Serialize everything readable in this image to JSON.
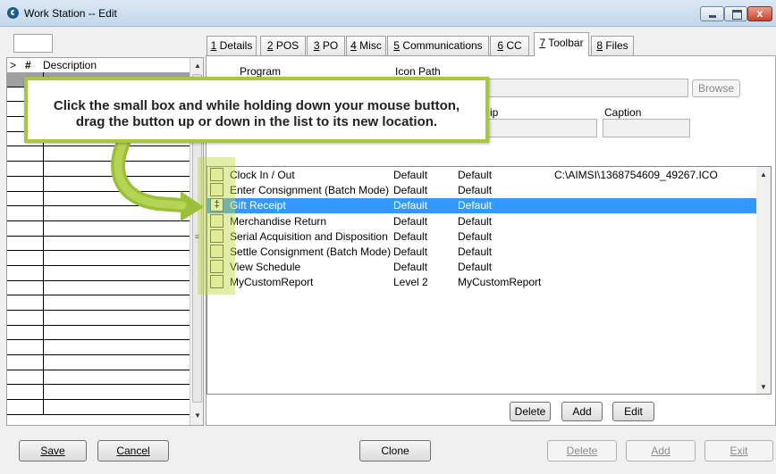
{
  "window": {
    "title": "Work Station -- Edit",
    "close_glyph": "x"
  },
  "left_list": {
    "headers": {
      "arrow": ">",
      "num": "#",
      "desc": "Description"
    },
    "row_count": 23,
    "selected_row": 0
  },
  "tabs": [
    {
      "key": "1",
      "label": " Details"
    },
    {
      "key": "2",
      "label": " POS"
    },
    {
      "key": "3",
      "label": " PO"
    },
    {
      "key": "4",
      "label": " Misc"
    },
    {
      "key": "5",
      "label": " Communications"
    },
    {
      "key": "6",
      "label": " CC"
    },
    {
      "key": "7",
      "label": " Toolbar"
    },
    {
      "key": "8",
      "label": " Files"
    }
  ],
  "active_tab": "7",
  "form": {
    "program_label": "Program",
    "icon_path_label": "Icon Path",
    "browse_label": "Browse",
    "tooltip_partial_label": "ip",
    "caption_label": "Caption"
  },
  "callout": {
    "line1": "Click the small box and while holding down your mouse button,",
    "line2": "drag the button up or down in the list to its new location."
  },
  "toolbar_items": [
    {
      "name": "Clock In / Out",
      "level": "Default",
      "caption": "Default",
      "icon": "C:\\AIMSI\\1368754609_49267.ICO"
    },
    {
      "name": "Enter Consignment (Batch Mode)",
      "level": "Default",
      "caption": "Default",
      "icon": ""
    },
    {
      "name": "Gift Receipt",
      "level": "Default",
      "caption": "Default",
      "icon": ""
    },
    {
      "name": "Merchandise Return",
      "level": "Default",
      "caption": "Default",
      "icon": ""
    },
    {
      "name": "Serial Acquisition and Disposition",
      "level": "Default",
      "caption": "Default",
      "icon": ""
    },
    {
      "name": "Settle Consignment (Batch Mode)",
      "level": "Default",
      "caption": "Default",
      "icon": ""
    },
    {
      "name": "View Schedule",
      "level": "Default",
      "caption": "Default",
      "icon": ""
    },
    {
      "name": "MyCustomReport",
      "level": "Level 2",
      "caption": "MyCustomReport",
      "icon": ""
    }
  ],
  "selected_toolbar_item": 2,
  "grip_glyph": "‡",
  "list_buttons": {
    "delete": "Delete",
    "add": "Add",
    "edit": "Edit"
  },
  "bottom_buttons": {
    "save": "Save",
    "cancel": "Cancel",
    "clone": "Clone",
    "delete": "Delete",
    "add": "Add",
    "exit": "Exit"
  },
  "colors": {
    "selection": "#3399ff",
    "callout_accent": "#a8c640"
  },
  "icons": {
    "app": "app-logo-icon",
    "minimize": "minimize-icon",
    "maximize": "maximize-icon",
    "close": "close-icon"
  }
}
